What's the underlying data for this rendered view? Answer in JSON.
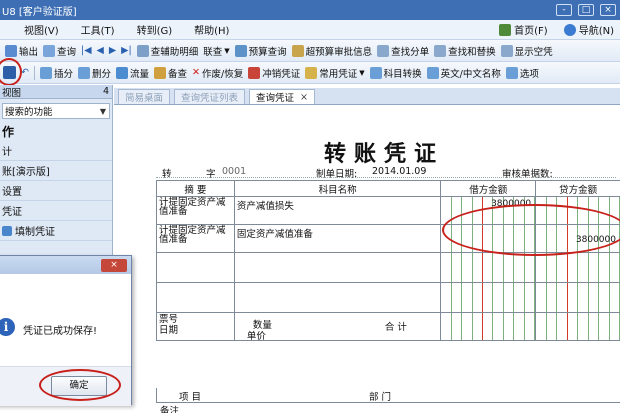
{
  "window": {
    "title": "U8 [客户验证版]",
    "controls": [
      "-",
      "□",
      "×"
    ]
  },
  "menu": {
    "items": [
      "视图(V)",
      "工具(T)",
      "转到(G)",
      "帮助(H)"
    ],
    "right": {
      "home": "首页(F)",
      "nav": "导航(N)"
    }
  },
  "toolbar1": {
    "items": [
      "输出",
      "查询",
      "查辅助明细",
      "联查",
      "预算查询",
      "超预算审批信息",
      "查找分单",
      "查找和替换",
      "显示空凭"
    ]
  },
  "toolbar2": {
    "items": [
      "插分",
      "删分",
      "流量",
      "备查",
      "作废/恢复",
      "冲销凭证",
      "常用凭证",
      "科目转换",
      "英文/中文名称",
      "选项"
    ]
  },
  "left_panel": {
    "header": "视图",
    "pin": "4",
    "search_placeholder": "搜索的功能",
    "section": "作",
    "items": [
      "计",
      "账[演示版]",
      "设置",
      "凭证",
      "填制凭证"
    ]
  },
  "tabs": [
    {
      "label": "简易桌面",
      "active": false
    },
    {
      "label": "查询凭证列表",
      "active": false
    },
    {
      "label": "查询凭证",
      "active": true,
      "close": "×"
    }
  ],
  "voucher": {
    "title": "转账凭证",
    "type_label": "转",
    "number_label": "字",
    "number": "0001",
    "date_label": "制单日期:",
    "date": "2014.01.09",
    "attach_label": "审核单据数:",
    "headers": {
      "summary": "摘 要",
      "account": "科目名称",
      "debit": "借方金额",
      "credit": "贷方金额"
    },
    "rows": [
      {
        "summary": "计提固定资产减值准备",
        "account": "资产减值损失",
        "debit": "3800000",
        "credit": ""
      },
      {
        "summary": "计提固定资产减值准备",
        "account": "固定资产减值准备",
        "debit": "",
        "credit": "3800000"
      },
      {
        "summary": "",
        "account": "",
        "debit": "",
        "credit": ""
      },
      {
        "summary": "",
        "account": "",
        "debit": "",
        "credit": ""
      }
    ],
    "footer": {
      "ticket_label": "票号",
      "date_label": "日期",
      "qty_label": "数量",
      "price_label": "单价",
      "total_label": "合 计",
      "project_label": "项 目",
      "dept_label": "部 门",
      "note_label": "备注"
    }
  },
  "dialog": {
    "close": "×",
    "message": "凭证已成功保存!",
    "ok": "确定",
    "icon": "info-icon"
  },
  "colors": {
    "titlebar": "#3e6fb4",
    "highlight_red": "#c8201a",
    "info_blue": "#2d63b8"
  }
}
